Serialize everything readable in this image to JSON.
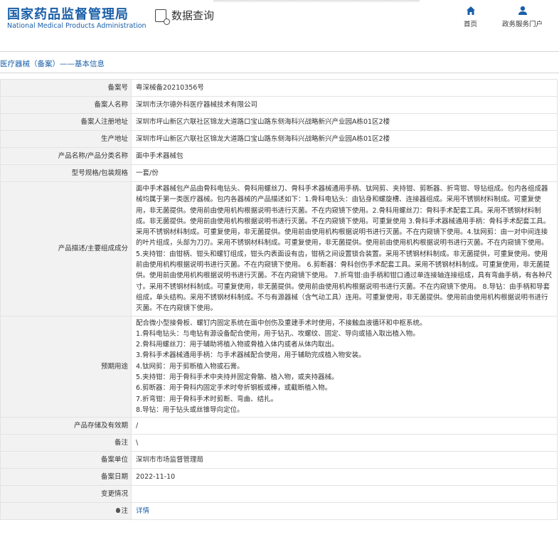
{
  "header": {
    "logo_cn": "国家药品监督管理局",
    "logo_en": "National Medical Products Administration",
    "query_label": "数据查询",
    "nav": [
      {
        "label": "首页",
        "icon": "home-icon"
      },
      {
        "label": "政务服务门户",
        "icon": "user-icon"
      }
    ]
  },
  "breadcrumb": "医疗器械（备案）——基本信息",
  "rows": [
    {
      "label": "备案号",
      "value": "粤深械备20210356号"
    },
    {
      "label": "备案人名称",
      "value": "深圳市沃尔德外科医疗器械技术有限公司"
    },
    {
      "label": "备案人注册地址",
      "value": "深圳市坪山新区六联社区锦龙大道路口宝山路东侧海科兴战略新兴产业园A栋01区2楼"
    },
    {
      "label": "生产地址",
      "value": "深圳市坪山新区六联社区锦龙大道路口宝山路东侧海科兴战略新兴产业园A栋01区2楼"
    },
    {
      "label": "产品名称/产品分类名称",
      "value": "面中手术器械包"
    },
    {
      "label": "型号规格/包装规格",
      "value": "一套/份"
    },
    {
      "label": "产品描述/主要组成成分",
      "value": "面中手术器械包产品由骨科电钻头、骨科用螺丝刀、骨科手术器械通用手柄、钛网剪、夹持钳、剪断器、折弯钳、导钻组成。包内各组成器械均属于第一类医疗器械。包内各器械的产品描述如下：1.骨科电钻头：由钻身和螺旋槽、连接器组成。采用不锈钢材料制成。可重复使用，非无菌提供。使用前由使用机构根据说明书进行灭菌。不在内窥镜下使用。2.骨科用螺丝刀：骨科手术配套工具。采用不锈钢材料制成。非无菌提供。使用前由使用机构根据说明书进行灭菌。不在内窥镜下使用。可重复使用 3.骨科手术器械通用手柄：骨科手术配套工具。采用不锈钢材料制成。可重复使用，非无菌提供。使用前由使用机构根据说明书进行灭菌。不在内窥镜下使用。4.钛网剪：由一对中间连接的叶片组成，头部为刀刃。采用不锈钢材料制成。可重复使用，非无菌提供。使用前由使用机构根据说明书进行灭菌。不在内窥镜下使用。 5.夹持钳：由钳柄、钳头和螺钉组成，钳头内表面设有齿，钳柄之间设置锁合装置。采用不锈钢材料制成。非无菌提供，可重复使用。使用前由使用机构根据说明书进行灭菌。不在内窥镜下使用。 6.剪断器：骨科创伤手术配套工具。采用不锈钢材料制成。可重复使用，非无菌提供。使用前由使用机构根据说明书进行灭菌。不在内窥镜下使用。 7.折弯钳:由手柄和钳口通过单连接轴连接组成，具有弯曲手柄，有各种尺寸。采用不锈钢材料制成。可重复使用，非无菌提供。使用前由使用机构根据说明书进行灭菌。不在内窥镜下使用。 8.导钻：由手柄和导套组成，单头结构。采用不锈钢材料制成。不与有源器械（含气动工具）连用。可重复使用，非无菌提供。使用前由使用机构根据说明书进行灭菌。不在内窥镜下使用。"
    },
    {
      "label": "预期用途",
      "lines": [
        "配合微小型接骨板、螺钉内固定系统在面中创伤及重建手术时使用，不接触血液循环和中枢系统。",
        "1.骨科电钻头：与电钻有源设备配合使用，用于钻孔、攻螺纹、固定、导向或插入取出植入物。",
        "2.骨科用螺丝刀：用于辅助将植入物或骨植入体内或者从体内取出。",
        "3.骨科手术器械通用手柄：与手术器械配合使用，用于辅助完成植入物安装。",
        "4.钛网剪：用于剪断植入物或石膏。",
        "5.夹持钳：用于骨科手术中夹持并固定骨骼、植入物，或夹持器械。",
        "6.剪断器：用于骨科内固定手术时夸折钢板或棒，或截断植入物。",
        "7.折弯钳：用于骨科手术时剪断、弯曲、结扎。",
        "8.导钻：用于钻头或丝锥导向定位。"
      ]
    },
    {
      "label": "产品存储及有效期",
      "value": "/"
    },
    {
      "label": "备注",
      "value": "\\"
    },
    {
      "label": "备案单位",
      "value": "深圳市市场监督管理局"
    },
    {
      "label": "备案日期",
      "value": "2022-11-10"
    },
    {
      "label": "变更情况",
      "value": ""
    },
    {
      "label": "注",
      "value": "详情",
      "link": true
    }
  ]
}
